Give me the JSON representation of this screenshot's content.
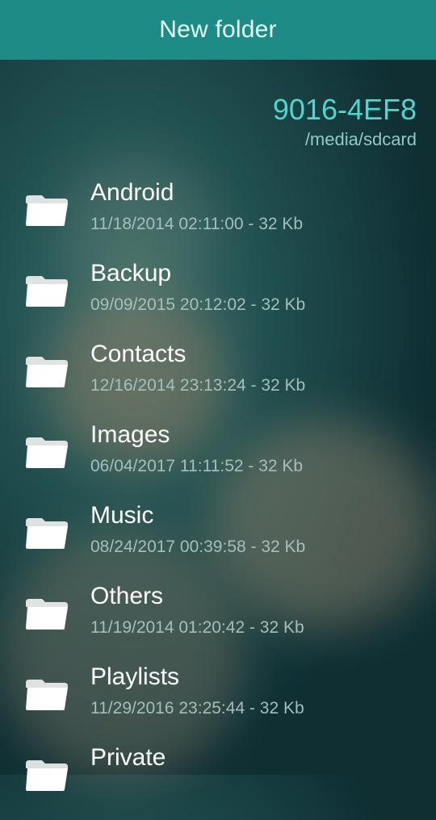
{
  "header": {
    "title": "New folder"
  },
  "location": {
    "volume": "9016-4EF8",
    "path": "/media/sdcard"
  },
  "folders": [
    {
      "name": "Android",
      "meta": "11/18/2014 02:11:00 - 32 Kb"
    },
    {
      "name": "Backup",
      "meta": "09/09/2015 20:12:02 - 32 Kb"
    },
    {
      "name": "Contacts",
      "meta": "12/16/2014 23:13:24 - 32 Kb"
    },
    {
      "name": "Images",
      "meta": "06/04/2017 11:11:52 - 32 Kb"
    },
    {
      "name": "Music",
      "meta": "08/24/2017 00:39:58 - 32 Kb"
    },
    {
      "name": "Others",
      "meta": "11/19/2014 01:20:42 - 32 Kb"
    },
    {
      "name": "Playlists",
      "meta": "11/29/2016 23:25:44 - 32 Kb"
    },
    {
      "name": "Private",
      "meta": ""
    }
  ],
  "icons": {
    "folder": "folder-icon"
  },
  "colors": {
    "accent": "#1e8b86",
    "highlight": "#52d4d0"
  }
}
